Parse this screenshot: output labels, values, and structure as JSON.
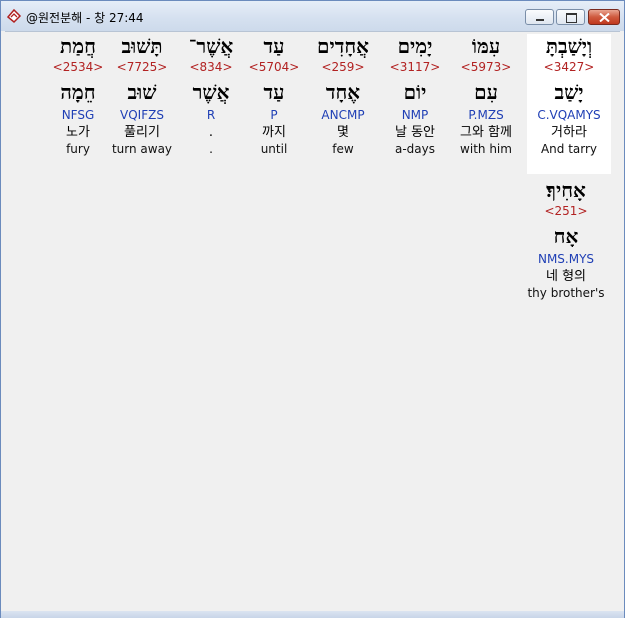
{
  "window": {
    "title": "@원전분해 - 창 27:44"
  },
  "words": [
    {
      "hebrew": "וְיָשַׁבְתָּ",
      "strong": "<3427>",
      "lemma": "יָשַׁב",
      "parse": "C.VQAMYS",
      "korean": "거하라",
      "english": "And tarry",
      "highlighted": true
    },
    {
      "hebrew": "עִמּוֹ",
      "strong": "<5973>",
      "lemma": "עִם",
      "parse": "P.MZS",
      "korean": "그와 함께",
      "english": "with him"
    },
    {
      "hebrew": "יָמִים",
      "strong": "<3117>",
      "lemma": "יוֹם",
      "parse": "NMP",
      "korean": "날 동안",
      "english": "a-days"
    },
    {
      "hebrew": "אֲחָדִים",
      "strong": "<259>",
      "lemma": "אֶחָד",
      "parse": "ANCMP",
      "korean": "몇",
      "english": "few"
    },
    {
      "hebrew": "עַד",
      "strong": "<5704>",
      "lemma": "עַד",
      "parse": "P",
      "korean": "까지",
      "english": "until"
    },
    {
      "hebrew": "אֲשֶׁר־",
      "strong": "<834>",
      "lemma": "אֲשֶׁר",
      "parse": "R",
      "korean": ".",
      "english": "."
    },
    {
      "hebrew": "תָּשׁוּב",
      "strong": "<7725>",
      "lemma": "שׁוּב",
      "parse": "VQIFZS",
      "korean": "풀리기",
      "english": "turn away"
    },
    {
      "hebrew": "חֲמַת",
      "strong": "<2534>",
      "lemma": "חֵמָה",
      "parse": "NFSG",
      "korean": "노가",
      "english": "fury"
    },
    {
      "hebrew": "אָחִיךָ׃",
      "strong": "<251>",
      "lemma": "אָח",
      "parse": "NMS.MYS",
      "korean": "네 형의",
      "english": "thy brother's"
    }
  ]
}
